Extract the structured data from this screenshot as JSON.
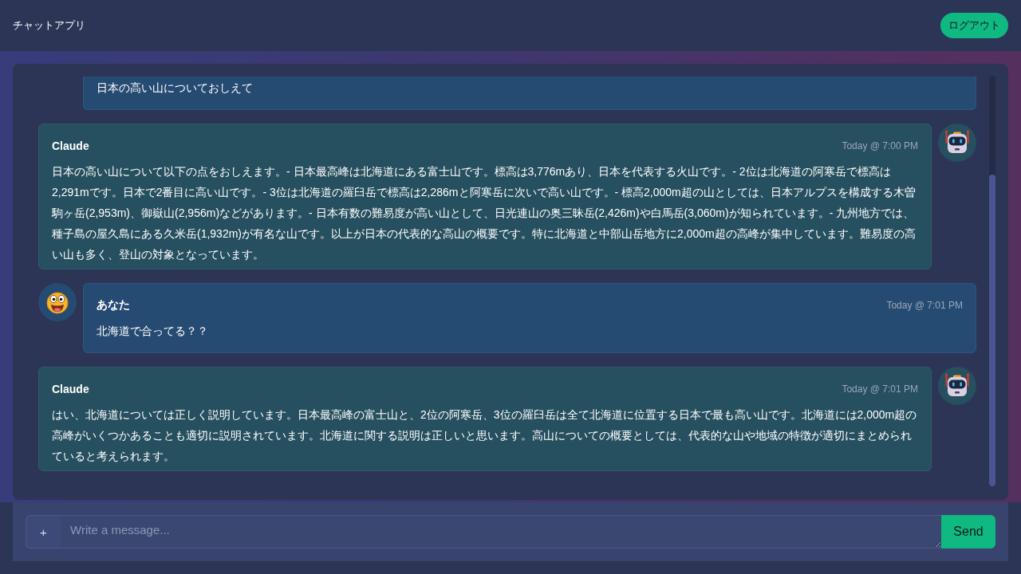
{
  "header": {
    "title": "チャットアプリ",
    "logout_button": "ログアウト"
  },
  "messages": [
    {
      "kind": "user",
      "partial": true,
      "text": "日本の高い山についておしえて"
    },
    {
      "kind": "assistant",
      "partial": false,
      "name": "Claude",
      "time": "Today @ 7:00 PM",
      "text": "日本の高い山について以下の点をおしえます。- 日本最高峰は北海道にある富士山です。標高は3,776mあり、日本を代表する火山です。- 2位は北海道の阿寒岳で標高は2,291mです。日本で2番目に高い山です。- 3位は北海道の羅臼岳で標高は2,286mと阿寒岳に次いで高い山です。- 標高2,000m超の山としては、日本アルプスを構成する木曽駒ヶ岳(2,953m)、御嶽山(2,956m)などがあります。- 日本有数の難易度が高い山として、日光連山の奥三昧岳(2,426m)や白馬岳(3,060m)が知られています。- 九州地方では、種子島の屋久島にある久米岳(1,932m)が有名な山です。以上が日本の代表的な高山の概要です。特に北海道と中部山岳地方に2,000m超の高峰が集中しています。難易度の高い山も多く、登山の対象となっています。"
    },
    {
      "kind": "user",
      "partial": false,
      "name": "あなた",
      "time": "Today @ 7:01 PM",
      "text": "北海道で合ってる？？"
    },
    {
      "kind": "assistant",
      "partial": false,
      "name": "Claude",
      "time": "Today @ 7:01 PM",
      "text": "はい、北海道については正しく説明しています。日本最高峰の富士山と、2位の阿寒岳、3位の羅臼岳は全て北海道に位置する日本で最も高い山です。北海道には2,000m超の高峰がいくつかあることも適切に説明されています。北海道に関する説明は正しいと思います。高山についての概要としては、代表的な山や地域の特徴が適切にまとめられていると考えられます。"
    }
  ],
  "composer": {
    "attach_button": "+",
    "placeholder": "Write a message...",
    "send_button": "Send"
  }
}
